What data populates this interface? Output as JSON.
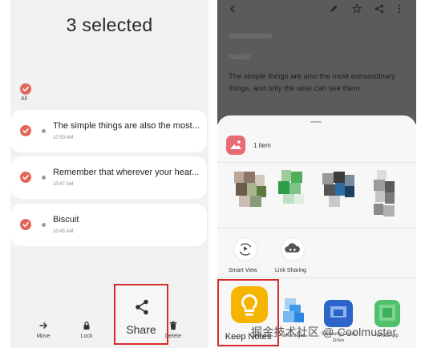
{
  "left_screen": {
    "title": "3 selected",
    "select_all_label": "All",
    "notes": [
      {
        "title": "The simple things are also the most...",
        "time": "10:50 AM"
      },
      {
        "title": "Remember that wherever your hear...",
        "time": "10:47 AM"
      },
      {
        "title": "Biscuit",
        "time": "10:45 AM"
      }
    ],
    "actions": {
      "move": "Move",
      "lock": "Lock",
      "share": "Share",
      "delete": "Delete"
    }
  },
  "right_screen": {
    "note_title": "Notitle",
    "note_body": "The simple things are also the most extraordinary things, and only the wise can see them",
    "sheet": {
      "item_count": "1 item",
      "quick_actions": [
        {
          "label": "Smart View",
          "icon": "smart-view-icon"
        },
        {
          "label": "Link Sharing",
          "icon": "cloud-link-icon"
        }
      ],
      "apps": [
        {
          "label": "Keep Notes",
          "icon": "lightbulb-icon"
        },
        {
          "label": "Messages",
          "icon": "messages-icon"
        },
        {
          "label": "Samsung Cloud Drive",
          "icon": "cloud-drive-icon"
        },
        {
          "label": "WhatsApp",
          "icon": "whatsapp-icon"
        }
      ]
    }
  },
  "watermark": "掘金技术社区 @ Coolmuster",
  "colors": {
    "check": "#e4665a",
    "highlight_border": "#d72a2a",
    "keep_notes": "#f4b400",
    "dim_overlay": "#5b5b5b"
  }
}
